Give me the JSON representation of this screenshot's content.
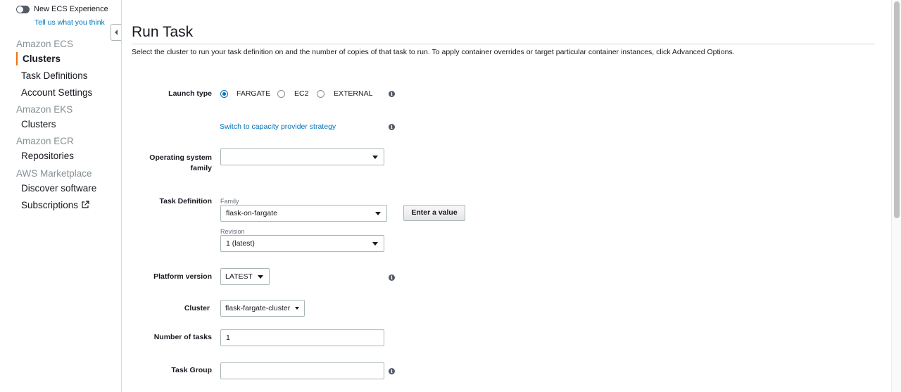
{
  "sidebar": {
    "toggle_label": "New ECS Experience",
    "feedback_link": "Tell us what you think",
    "sections": [
      {
        "title": "Amazon ECS",
        "items": [
          "Clusters",
          "Task Definitions",
          "Account Settings"
        ]
      },
      {
        "title": "Amazon EKS",
        "items": [
          "Clusters"
        ]
      },
      {
        "title": "Amazon ECR",
        "items": [
          "Repositories"
        ]
      },
      {
        "title": "AWS Marketplace",
        "items": [
          "Discover software",
          "Subscriptions"
        ]
      }
    ],
    "active_item": "Clusters"
  },
  "page": {
    "title": "Run Task",
    "description": "Select the cluster to run your task definition on and the number of copies of that task to run. To apply container overrides or target particular container instances, click Advanced Options."
  },
  "form": {
    "launch_type": {
      "label": "Launch type",
      "options": [
        "FARGATE",
        "EC2",
        "EXTERNAL"
      ],
      "selected": "FARGATE"
    },
    "capacity_link": "Switch to capacity provider strategy",
    "os_family": {
      "label": "Operating system family",
      "value": ""
    },
    "task_definition": {
      "label": "Task Definition",
      "family_label": "Family",
      "family_value": "flask-on-fargate",
      "enter_value_button": "Enter a value",
      "revision_label": "Revision",
      "revision_value": "1 (latest)"
    },
    "platform_version": {
      "label": "Platform version",
      "value": "LATEST"
    },
    "cluster": {
      "label": "Cluster",
      "value": "flask-fargate-cluster"
    },
    "num_tasks": {
      "label": "Number of tasks",
      "value": "1"
    },
    "task_group": {
      "label": "Task Group",
      "value": ""
    }
  },
  "icons": {
    "info": "info-icon",
    "external": "external-link-icon",
    "collapse": "caret-left-icon"
  },
  "colors": {
    "accent": "#ec7211",
    "link": "#0073bb",
    "text": "#16191f",
    "muted": "#879196"
  }
}
